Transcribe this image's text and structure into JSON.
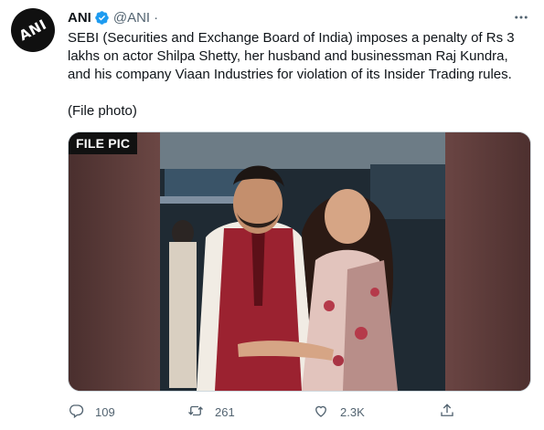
{
  "account": {
    "avatar_text": "ANI",
    "name": "ANI",
    "handle": "@ANI",
    "separator": "·"
  },
  "tweet": {
    "text": "SEBI (Securities and Exchange Board of India) imposes a penalty of Rs 3 lakhs on actor Shilpa Shetty, her husband and businessman Raj Kundra, and his company Viaan Industries for violation of its Insider Trading rules.",
    "caption": "(File photo)"
  },
  "media": {
    "badge": "FILE PIC"
  },
  "actions": {
    "replies": "109",
    "retweets": "261",
    "likes": "2.3K"
  },
  "colors": {
    "verified": "#1d9bf0",
    "muted": "#536471",
    "text": "#0f1419"
  },
  "icons": [
    "more-icon",
    "verified-icon",
    "reply-icon",
    "retweet-icon",
    "like-icon",
    "share-icon"
  ]
}
